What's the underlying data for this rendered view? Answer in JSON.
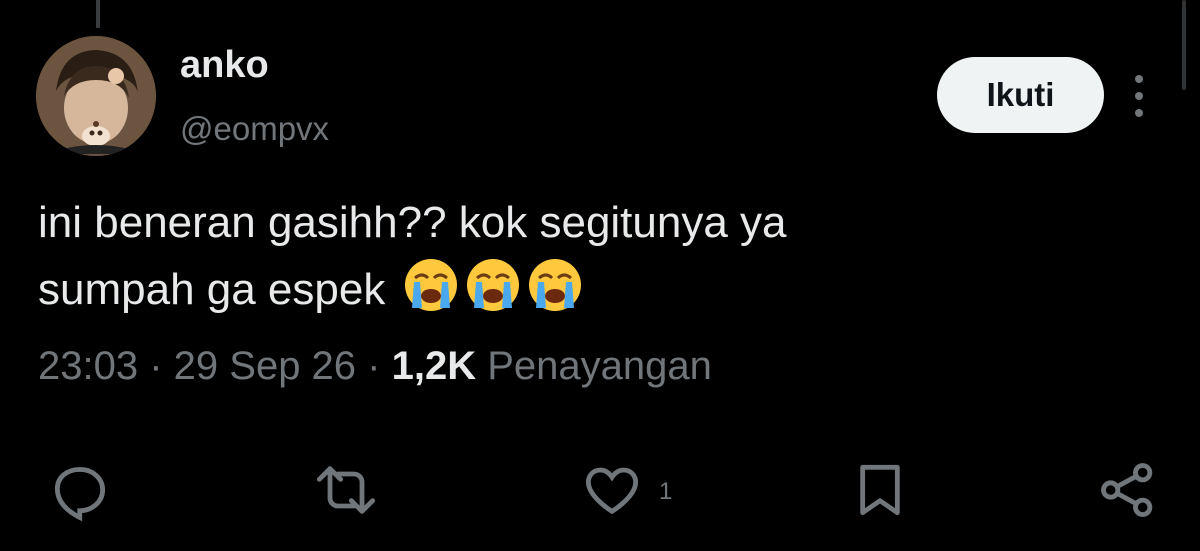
{
  "user": {
    "name": "anko",
    "handle": "@eompvx"
  },
  "follow_label": "Ikuti",
  "tweet": {
    "line1": "ini beneran gasihh?? kok segitunya ya",
    "line2": "sumpah ga espek",
    "emoji": [
      "loudly-crying-face",
      "loudly-crying-face",
      "loudly-crying-face"
    ]
  },
  "meta": {
    "time": "23:03",
    "sep1": " · ",
    "date": "29 Sep 26",
    "sep2": " · ",
    "views_count": "1,2K",
    "views_label": " Penayangan"
  },
  "actions": {
    "like_count": "1",
    "icons": [
      "reply-icon",
      "retweet-icon",
      "heart-icon",
      "bookmark-icon",
      "share-icon"
    ]
  },
  "colors": {
    "background": "#000000",
    "text": "#e7e9ea",
    "secondary": "#71767b",
    "button_bg": "#eff3f4"
  }
}
